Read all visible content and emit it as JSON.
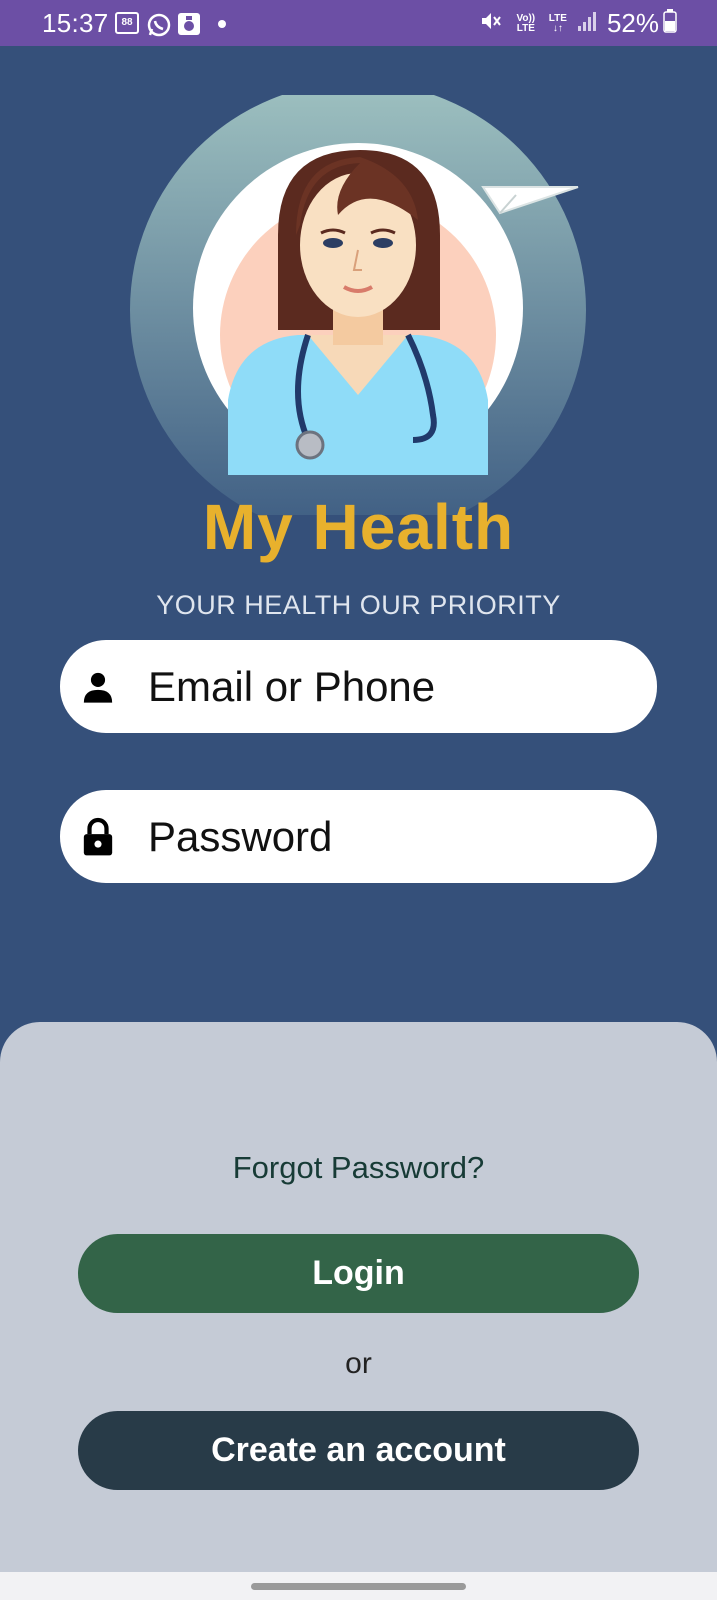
{
  "status_bar": {
    "time": "15:37",
    "battery": "52%",
    "network": "LTE",
    "volte": "Vo)) LTE",
    "icons": [
      "notification-icon",
      "whatsapp-icon",
      "media-icon",
      "dot-icon",
      "mute-icon",
      "volte-icon",
      "lte-icon",
      "signal-icon",
      "battery-icon"
    ]
  },
  "app": {
    "title": "My Health",
    "tagline": "YOUR HEALTH OUR PRIORITY"
  },
  "login_form": {
    "email_placeholder": "Email or Phone",
    "password_placeholder": "Password",
    "email_icon": "person-icon",
    "password_icon": "lock-icon"
  },
  "actions": {
    "forgot_password": "Forgot Password?",
    "login": "Login",
    "or": "or",
    "create_account": "Create an account"
  },
  "colors": {
    "status_bar": "#6c4fa5",
    "background": "#35507a",
    "title": "#e8b12d",
    "sheet": "#c5cbd6",
    "login_button": "#336448",
    "create_button": "#283b48"
  }
}
